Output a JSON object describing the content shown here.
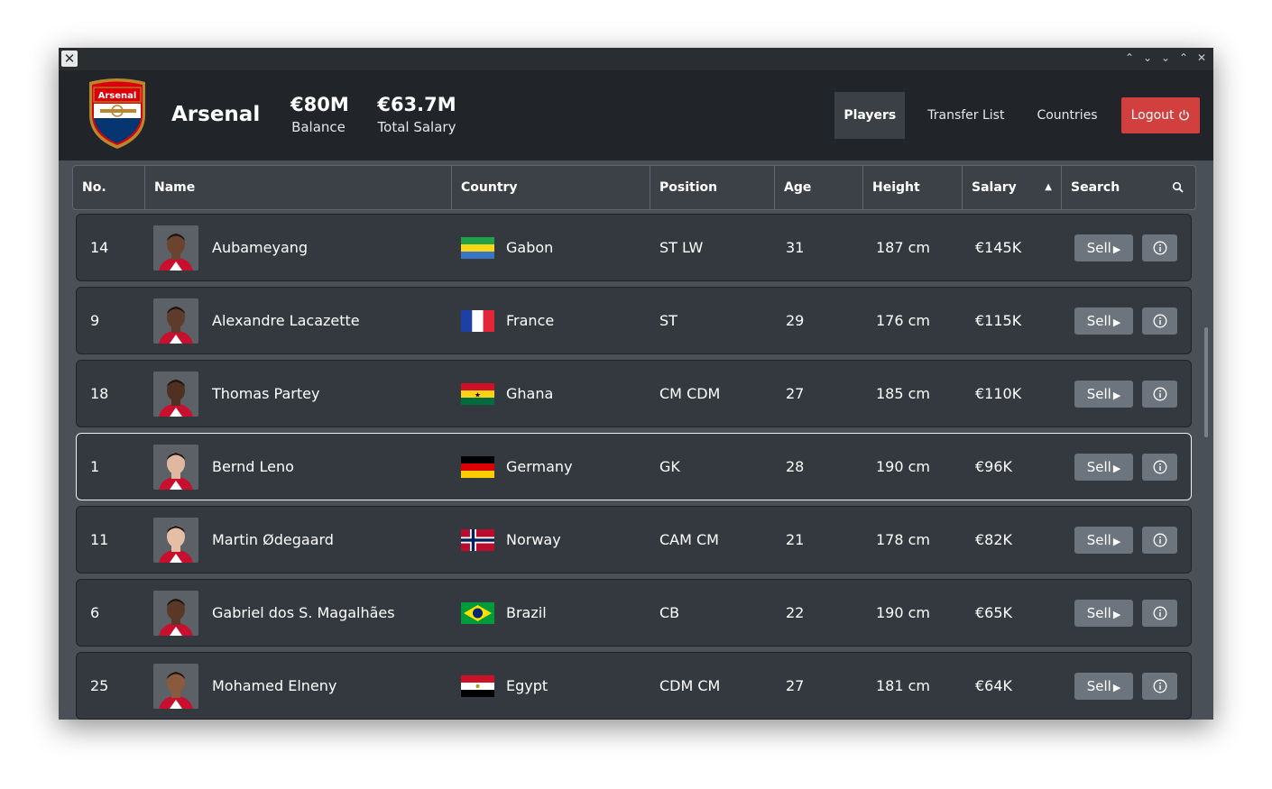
{
  "window": {
    "controls": [
      "up-double",
      "down-double",
      "down",
      "up",
      "close"
    ]
  },
  "header": {
    "crest_text": "Arsenal",
    "team_name": "Arsenal",
    "balance": {
      "value": "€80M",
      "label": "Balance"
    },
    "total_salary": {
      "value": "€63.7M",
      "label": "Total Salary"
    },
    "nav": {
      "players": "Players",
      "transfer_list": "Transfer List",
      "countries": "Countries",
      "logout": "Logout"
    }
  },
  "table": {
    "columns": {
      "no": "No.",
      "name": "Name",
      "country": "Country",
      "position": "Position",
      "age": "Age",
      "height": "Height",
      "salary": "Salary",
      "search": "Search"
    },
    "sort": {
      "column": "Salary",
      "direction": "asc-indicator",
      "glyph": "▲"
    },
    "rows": [
      {
        "no": "14",
        "name": "Aubameyang",
        "country": "Gabon",
        "position": "ST LW",
        "age": "31",
        "height": "187 cm",
        "salary": "€145K",
        "sell": "Sell",
        "skin": "#6b4430"
      },
      {
        "no": "9",
        "name": "Alexandre Lacazette",
        "country": "France",
        "position": "ST",
        "age": "29",
        "height": "176 cm",
        "salary": "€115K",
        "sell": "Sell",
        "skin": "#5e3b2a"
      },
      {
        "no": "18",
        "name": "Thomas Partey",
        "country": "Ghana",
        "position": "CM CDM",
        "age": "27",
        "height": "185 cm",
        "salary": "€110K",
        "sell": "Sell",
        "skin": "#4f3022"
      },
      {
        "no": "1",
        "name": "Bernd Leno",
        "country": "Germany",
        "position": "GK",
        "age": "28",
        "height": "190 cm",
        "salary": "€96K",
        "sell": "Sell",
        "skin": "#e0b8a0"
      },
      {
        "no": "11",
        "name": "Martin Ødegaard",
        "country": "Norway",
        "position": "CAM CM",
        "age": "21",
        "height": "178 cm",
        "salary": "€82K",
        "sell": "Sell",
        "skin": "#e5bea6"
      },
      {
        "no": "6",
        "name": "Gabriel dos S. Magalhães",
        "country": "Brazil",
        "position": "CB",
        "age": "22",
        "height": "190 cm",
        "salary": "€65K",
        "sell": "Sell",
        "skin": "#5a3828"
      },
      {
        "no": "25",
        "name": "Mohamed Elneny",
        "country": "Egypt",
        "position": "CDM CM",
        "age": "27",
        "height": "181 cm",
        "salary": "€64K",
        "sell": "Sell",
        "skin": "#8a5a3c"
      }
    ],
    "selected_row": "1"
  },
  "colors": {
    "logout": "#d23f3f",
    "header_bg": "#212529",
    "table_bg": "#495057",
    "row_bg": "#33393e",
    "button": "#6c757d"
  }
}
